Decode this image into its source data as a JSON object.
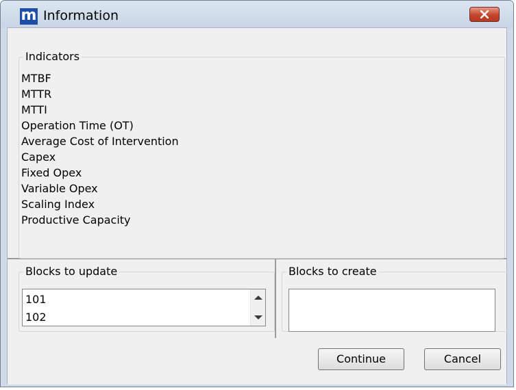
{
  "window": {
    "title": "Information",
    "logo_letter": "m"
  },
  "indicators": {
    "legend": "Indicators",
    "items": [
      "MTBF",
      "MTTR",
      "MTTI",
      "Operation Time (OT)",
      "Average Cost of Intervention",
      "Capex",
      "Fixed Opex",
      "Variable Opex",
      "Scaling Index",
      "Productive Capacity"
    ]
  },
  "blocks_to_update": {
    "legend": "Blocks to update",
    "items": [
      "101",
      "102"
    ]
  },
  "blocks_to_create": {
    "legend": "Blocks to create",
    "items": []
  },
  "buttons": {
    "continue_label": "Continue",
    "cancel_label": "Cancel"
  },
  "colors": {
    "logo_blue": "#1f4ea8",
    "close_red": "#c4442c"
  }
}
